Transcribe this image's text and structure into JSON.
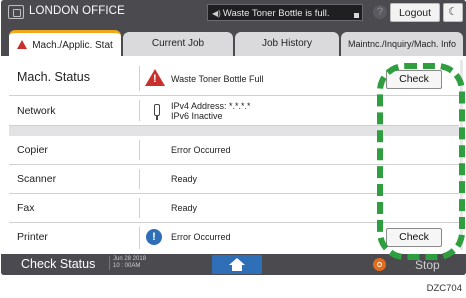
{
  "header": {
    "office_name": "LONDON OFFICE",
    "status_message": "Waste Toner Bottle is full.",
    "help_symbol": "?",
    "logout_label": "Logout",
    "moon_symbol": "☾"
  },
  "tabs": [
    {
      "label": "Mach./Applic. Stat",
      "active": true
    },
    {
      "label": "Current Job",
      "active": false
    },
    {
      "label": "Job History",
      "active": false
    },
    {
      "label": "Maintnc./Inquiry/Mach. Info",
      "active": false
    }
  ],
  "status_rows": {
    "machine": {
      "label": "Mach. Status",
      "value": "Waste Toner Bottle Full",
      "icon": "warning-icon",
      "action": "Check"
    },
    "network": {
      "label": "Network",
      "value_line1": "IPv4 Address: *.*.*.*",
      "value_line2": "IPv6 Inactive",
      "icon": "usb-icon"
    },
    "copier": {
      "label": "Copier",
      "value": "Error Occurred"
    },
    "scanner": {
      "label": "Scanner",
      "value": "Ready"
    },
    "fax": {
      "label": "Fax",
      "value": "Ready"
    },
    "printer": {
      "label": "Printer",
      "value": "Error Occurred",
      "icon": "info-icon",
      "action": "Check"
    }
  },
  "footer": {
    "check_status_label": "Check Status",
    "date": "Jun 28 2018",
    "time": "10 : 00AM",
    "stop_label": "Stop"
  },
  "figure_code": "DZC704",
  "colors": {
    "highlight": "#2f9e3f",
    "warning": "#c9302c",
    "info": "#2e6fb8",
    "tab_accent": "#f0a81a"
  }
}
